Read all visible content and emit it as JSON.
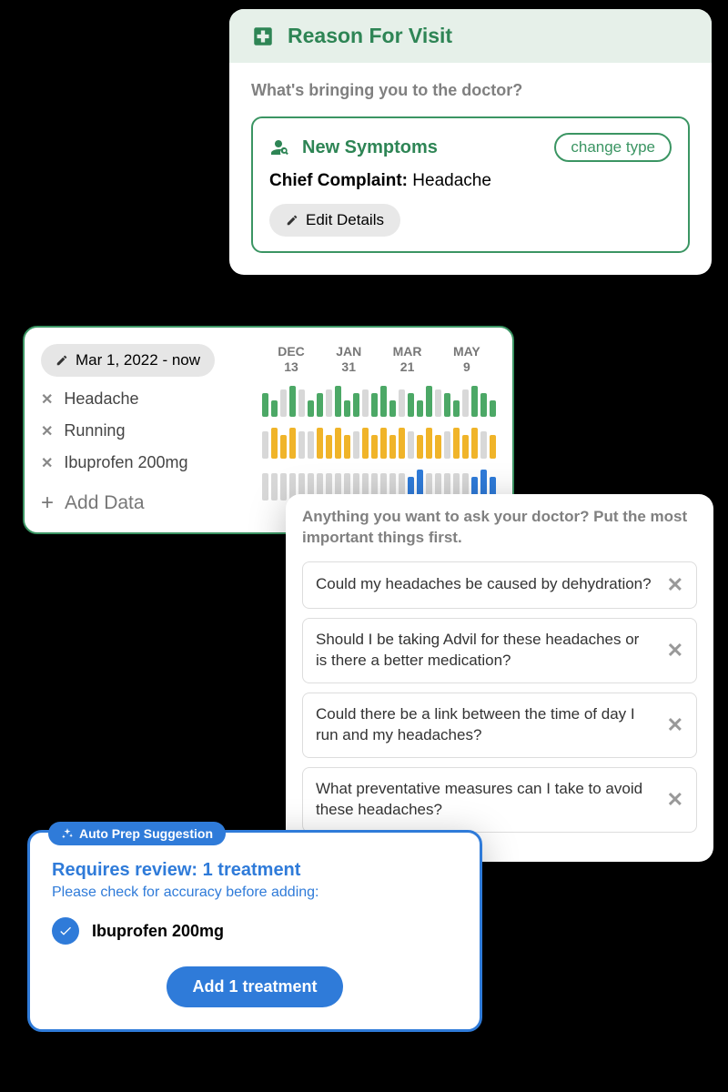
{
  "reason": {
    "header": "Reason For Visit",
    "prompt": "What's bringing you to the doctor?",
    "symptom_title": "New Symptoms",
    "change_type": "change type",
    "complaint_label": "Chief Complaint:",
    "complaint_value": "Headache",
    "edit_details": "Edit Details"
  },
  "tracking": {
    "date_range": "Mar 1, 2022 - now",
    "items": [
      "Headache",
      "Running",
      "Ibuprofen 200mg"
    ],
    "add_data": "Add Data",
    "timeline_dates": [
      {
        "month": "DEC",
        "day": "13"
      },
      {
        "month": "JAN",
        "day": "31"
      },
      {
        "month": "MAR",
        "day": "21"
      },
      {
        "month": "MAY",
        "day": "9"
      }
    ]
  },
  "questions": {
    "prompt": "Anything you want to ask your doctor? Put the most important things first.",
    "items": [
      "Could my headaches be caused by dehydration?",
      "Should I be taking Advil for these headaches or is there a better medication?",
      "Could there be a link between the time of day I run and my headaches?",
      "What preventative measures can I take to avoid these headaches?"
    ]
  },
  "autoprep": {
    "badge": "Auto Prep Suggestion",
    "title": "Requires review: 1 treatment",
    "subtitle": "Please check for accuracy before adding:",
    "treatment": "Ibuprofen 200mg",
    "button": "Add 1 treatment"
  }
}
